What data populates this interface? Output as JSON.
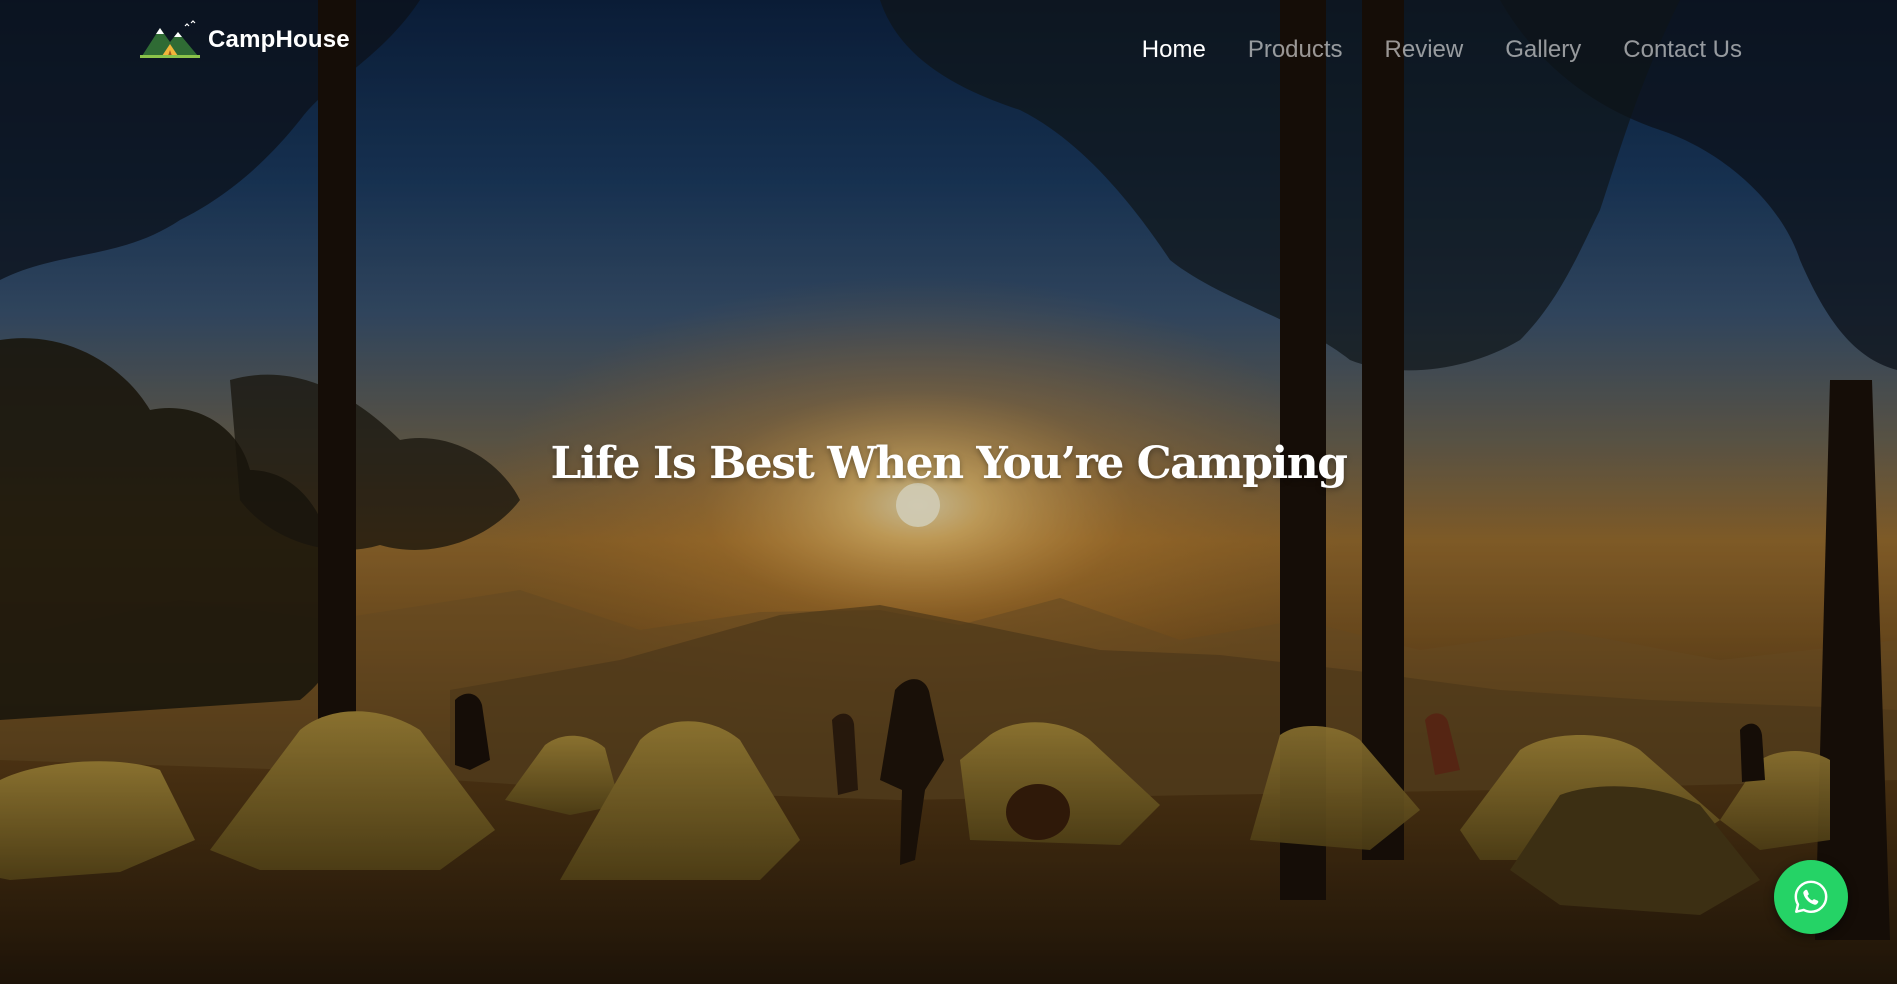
{
  "brand": {
    "name": "CampHouse",
    "logo_icon": "mountain-tent-icon"
  },
  "nav": {
    "items": [
      {
        "label": "Home",
        "active": true
      },
      {
        "label": "Products",
        "active": false
      },
      {
        "label": "Review",
        "active": false
      },
      {
        "label": "Gallery",
        "active": false
      },
      {
        "label": "Contact Us",
        "active": false
      }
    ]
  },
  "hero": {
    "headline": "Life Is Best When You’re Camping",
    "background": "sunset campsite with tents under pine trees"
  },
  "floating_button": {
    "icon": "whatsapp-icon",
    "color": "#25d366"
  },
  "colors": {
    "nav_active": "#ffffff",
    "nav_inactive": "#bdbdbd",
    "accent": "#25d366"
  }
}
